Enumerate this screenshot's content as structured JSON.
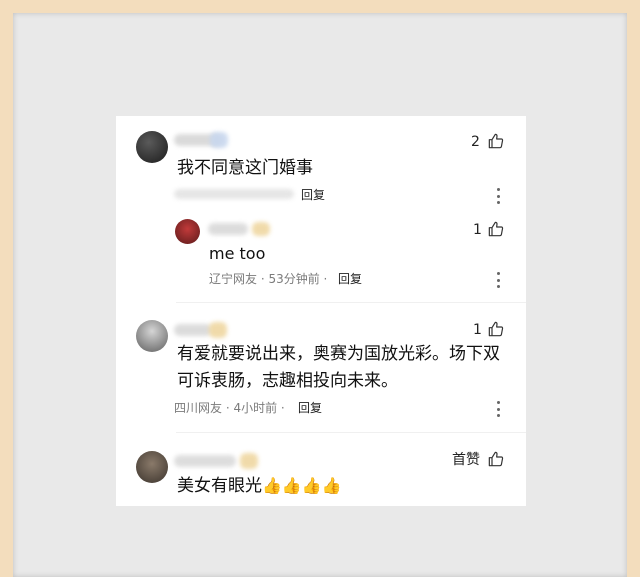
{
  "comments": [
    {
      "text": "我不同意这门婚事",
      "likes": "2",
      "reply_label": "回复",
      "icons": {
        "like": "thumb-up-icon",
        "more": "more-vertical-icon"
      }
    },
    {
      "text": "me too",
      "likes": "1",
      "meta": "辽宁网友 · 53分钟前 · ",
      "reply_label": "回复"
    },
    {
      "text_line1": "有爱就要说出来，奥赛为国放光彩。场下双",
      "text_line2": "可诉衷肠，志趣相投向未来。",
      "likes": "1",
      "meta": "四川网友 · 4小时前 · ",
      "reply_label": "回复"
    },
    {
      "text": "美女有眼光",
      "likes_label": "首赞",
      "emoji": "👍👍👍👍"
    }
  ]
}
